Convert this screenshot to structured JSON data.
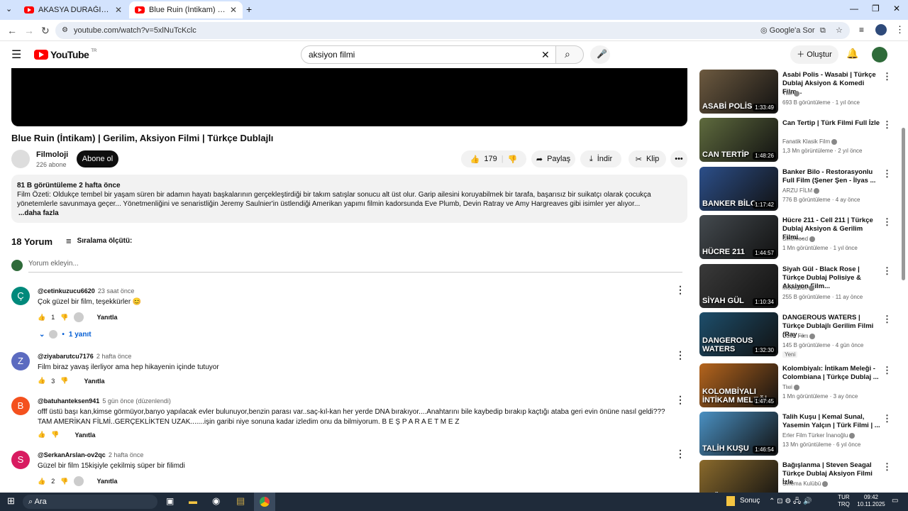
{
  "browser": {
    "tabs": [
      {
        "title": "AKASYA DURAĞI 45. BÖLÜM - Y..."
      },
      {
        "title": "Blue Ruin (İntikam) | Gerilim..."
      }
    ],
    "url": "youtube.com/watch?v=5xlNuTcKclc",
    "ask_google": "Google'a Sor"
  },
  "yt": {
    "logo": "YouTube",
    "region": "TR",
    "search_value": "aksiyon filmi",
    "create_label": "Oluştur"
  },
  "video": {
    "title": "Blue Ruin (İntikam) | Gerilim, Aksiyon Filmi | Türkçe Dublajlı",
    "channel": "Filmoloji",
    "subscribers": "226 abone",
    "subscribe_label": "Abone ol",
    "likes": "179",
    "share_label": "Paylaş",
    "download_label": "İndir",
    "clip_label": "Klip",
    "views_line": "81 B görüntüleme  2 hafta önce",
    "description": "Film Özeti: Oldukçe tembel bir yaşam süren bir adamın hayatı başkalarının gerçekleştirdiği bir takım satışlar sonucu alt üst olur. Garip ailesini koruyabilmek bir tarafa, başarısız bir suikatçı olarak çocukça yönetemlerle savunmaya geçer... Yönetmenliğini ve senaristliğin Jeremy Saulnier'in üstlendiği Amerikan yapımı filmin kadorsunda Eve Plumb, Devin Ratray ve Amy Hargreaves gibi isimler yer alıyor...",
    "more_label": "...daha fazla"
  },
  "comments_section": {
    "count_label": "18 Yorum",
    "sort_label": "Sıralama ölçütü:",
    "add_placeholder": "Yorum ekleyin...",
    "reply_label": "Yanıtla",
    "comments": [
      {
        "initial": "Ç",
        "color": "#00897b",
        "handle": "@cetinkuzucu6620",
        "time": "23 saat önce",
        "text": "Çok güzel bir film, teşekkürler 😊",
        "likes": "1",
        "replies": "1 yanıt"
      },
      {
        "initial": "Z",
        "color": "#5c6bc0",
        "handle": "@ziyabarutcu7176",
        "time": "2 hafta önce",
        "text": "Film biraz yavaş ilerliyor ama hep hikayenin içinde tutuyor",
        "likes": "3"
      },
      {
        "initial": "B",
        "color": "#f4511e",
        "handle": "@batuhanteksen941",
        "time": "5 gün önce (düzenlendi)",
        "text": "offf üstü başı kan,kimse görmüyor,banyo yapılacak evler bulunuyor,benzin parası var..saç-kıl-kan  her yerde DNA bırakıyor....Anahtarını bile kaybedip bırakıp kaçtığı ataba geri evin önüne nasıl geldi???TAM AMERİKAN FİLMİ..GERÇEKLİKTEN UZAK.......işin garibi niye sonuna kadar izledim onu da bilmiyorum. B E Ş   P A R A   E T M E Z",
        "likes": ""
      },
      {
        "initial": "S",
        "color": "#d81b60",
        "handle": "@SerkanArslan-ov2qc",
        "time": "2 hafta önce",
        "text": "Güzel bir film 15kişiyle çekilmiş süper bir filimdi",
        "likes": "2"
      }
    ]
  },
  "recommendations": [
    {
      "title": "Asabi Polis - Wasabi | Türkçe Dublaj Aksiyon & Komedi Film...",
      "channel": "Tiwi",
      "meta": "693 B görüntüleme · 1 yıl önce",
      "duration": "1:33:49",
      "thumb_label": "ASABİ POLİS",
      "color": "#6d5a40"
    },
    {
      "title": "Can Tertip | Türk Filmi Full İzle",
      "channel": "Fanatik Klasik Film",
      "meta": "1,3 Mn görüntüleme · 2 yıl önce",
      "duration": "1:48:26",
      "thumb_label": "CAN TERTİP",
      "color": "#5f6b3e"
    },
    {
      "title": "Banker Bilo - Restorasyonlu Full Film (Şener Şen - İlyas ...",
      "channel": "ARZU FİLM",
      "meta": "776 B görüntüleme · 4 ay önce",
      "duration": "1:17:42",
      "thumb_label": "BANKER BİLO",
      "color": "#2c4f8a"
    },
    {
      "title": "Hücre 211 - Cell 211 | Türkçe Dublaj Aksiyon & Gerilim Filmi...",
      "channel": "Sinemood",
      "meta": "1 Mn görüntüleme · 1 yıl önce",
      "duration": "1:44:57",
      "thumb_label": "HÜCRE 211",
      "color": "#444a4f"
    },
    {
      "title": "Siyah Gül - Black Rose | Türkçe Dublaj Polisiye & Aksiyon Film...",
      "channel": "MovieBox",
      "meta": "255 B görüntüleme · 11 ay önce",
      "duration": "1:10:34",
      "thumb_label": "SİYAH GÜL",
      "color": "#3a3a3a"
    },
    {
      "title": "DANGEROUS WATERS | Türkçe Dublajlı Gerilim Filmi (Ray ...",
      "channel": "Özen Film",
      "meta": "145 B görüntüleme · 4 gün önce",
      "duration": "1:32:30",
      "thumb_label": "DANGEROUS WATERS",
      "color": "#1d4e6b",
      "badge": "Yeni"
    },
    {
      "title": "Kolombiyalı: İntikam Meleği - Colombiana | Türkçe Dublaj ...",
      "channel": "Tiwi",
      "meta": "1 Mn görüntüleme · 3 ay önce",
      "duration": "1:47:45",
      "thumb_label": "KOLOMBİYALI İNTİKAM MELEĞİ",
      "color": "#b5651d"
    },
    {
      "title": "Talih Kuşu | Kemal Sunal, Yasemin Yalçın | Türk Filmi | ...",
      "channel": "Erler Film Türker İnanoğlu",
      "meta": "13 Mn görüntüleme · 6 yıl önce",
      "duration": "1:46:54",
      "thumb_label": "TALİH KUŞU",
      "color": "#4a90c2"
    },
    {
      "title": "Bağışlanma | Steven Seagal Türkçe Dublaj Aksiyon Filmi İzle",
      "channel": "Sinema Kulübü",
      "meta": "",
      "duration": "",
      "thumb_label": "BAĞIŞLANMA",
      "color": "#8a6a2c"
    }
  ],
  "taskbar": {
    "search_label": "Ara",
    "weather_label": "Sonuç",
    "lang_top": "TUR",
    "lang_bottom": "TRQ",
    "time": "09:42",
    "date": "10.11.2025"
  }
}
